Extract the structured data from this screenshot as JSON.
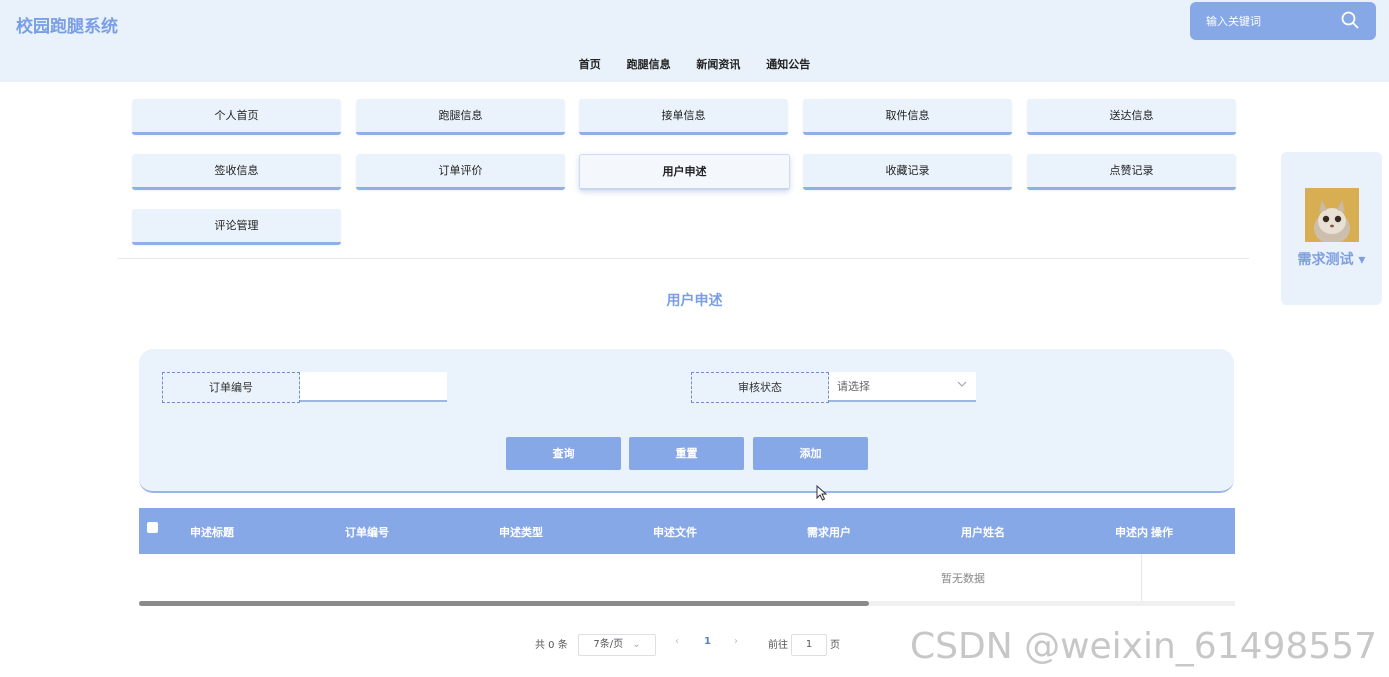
{
  "header": {
    "brand": "校园跑腿系统",
    "search_placeholder": "输入关键词",
    "nav": [
      "首页",
      "跑腿信息",
      "新闻资讯",
      "通知公告"
    ]
  },
  "menu": [
    {
      "label": "个人首页"
    },
    {
      "label": "跑腿信息"
    },
    {
      "label": "接单信息"
    },
    {
      "label": "取件信息"
    },
    {
      "label": "送达信息"
    },
    {
      "label": "签收信息"
    },
    {
      "label": "订单评价"
    },
    {
      "label": "用户申述",
      "active": true
    },
    {
      "label": "收藏记录"
    },
    {
      "label": "点赞记录"
    },
    {
      "label": "评论管理"
    }
  ],
  "user": {
    "name": "需求测试 ▾"
  },
  "page_title": "用户申述",
  "filter": {
    "order_no_label": "订单编号",
    "order_no_value": "",
    "status_label": "审核状态",
    "status_placeholder": "请选择",
    "btn_query": "查询",
    "btn_reset": "重置",
    "btn_add": "添加"
  },
  "table": {
    "columns": [
      "申述标题",
      "订单编号",
      "申述类型",
      "申述文件",
      "需求用户",
      "用户姓名",
      "申述内",
      "操作"
    ],
    "empty_text": "暂无数据"
  },
  "pagination": {
    "total": "共 0 条",
    "page_size": "7条/页",
    "current_page": "1",
    "goto_label": "前往",
    "goto_value": "1",
    "page_suffix": "页"
  },
  "watermark": "CSDN @weixin_61498557",
  "colors": {
    "accent": "#86a8e7",
    "header_bg": "#e9f2fb",
    "title": "#7a9ee6"
  }
}
